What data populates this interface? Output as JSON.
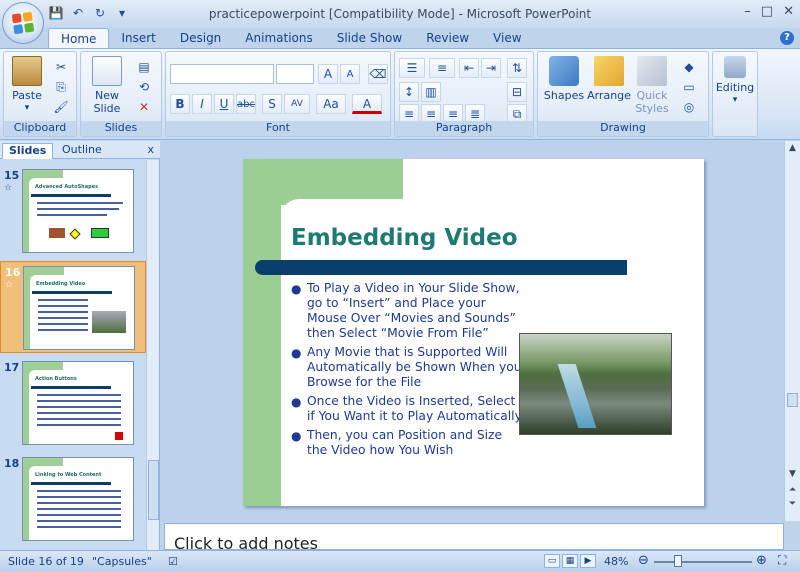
{
  "window": {
    "title": "practicepowerpoint [Compatibility Mode] - Microsoft PowerPoint",
    "controls": [
      "–",
      "□",
      "✕"
    ]
  },
  "qat": {
    "save": "💾",
    "undo": "↶",
    "redo": "↻",
    "more": "▾"
  },
  "tabs": [
    {
      "label": "Home",
      "active": true
    },
    {
      "label": "Insert"
    },
    {
      "label": "Design"
    },
    {
      "label": "Animations"
    },
    {
      "label": "Slide Show"
    },
    {
      "label": "Review"
    },
    {
      "label": "View"
    }
  ],
  "help": "?",
  "ribbon": {
    "clipboard": {
      "label": "Clipboard",
      "paste": "Paste"
    },
    "slides": {
      "label": "Slides",
      "new_slide": "New Slide"
    },
    "font": {
      "label": "Font",
      "bold": "B",
      "italic": "I",
      "underline": "U",
      "strike": "abc",
      "shadow": "S",
      "spacing": "AV",
      "case": "Aa",
      "color": "A",
      "grow": "A",
      "shrink": "A"
    },
    "paragraph": {
      "label": "Paragraph"
    },
    "drawing": {
      "label": "Drawing",
      "shapes": "Shapes",
      "arrange": "Arrange",
      "quick_styles": "Quick Styles"
    },
    "editing": {
      "label": "Editing"
    }
  },
  "panes": {
    "slides_tab": "Slides",
    "outline_tab": "Outline",
    "close": "x"
  },
  "thumbnails": [
    {
      "num": "15",
      "title": "Advanced AutoShapes",
      "selected": false
    },
    {
      "num": "16",
      "title": "Embedding Video",
      "selected": true
    },
    {
      "num": "17",
      "title": "Action Buttons",
      "selected": false
    },
    {
      "num": "18",
      "title": "Linking to Web Content",
      "selected": false
    }
  ],
  "slide": {
    "title": "Embedding Video",
    "bullets": [
      "To Play a Video in Your Slide Show, go to “Insert” and Place your Mouse Over “Movies and Sounds” then Select “Movie From File”",
      "Any Movie that is Supported Will Automatically be Shown When you Browse for the File",
      "Once the Video is Inserted, Select if You Want it to Play Automatically",
      "Then, you can Position and Size the Video how You Wish"
    ]
  },
  "notes": {
    "placeholder": "Click to add notes"
  },
  "status": {
    "slide_info": "Slide 16 of 19",
    "theme": "\"Capsules\"",
    "zoom": "48%"
  },
  "colors": {
    "accent": "#1e7b72",
    "green": "#9bcd94",
    "navy": "#0b3f6b"
  }
}
